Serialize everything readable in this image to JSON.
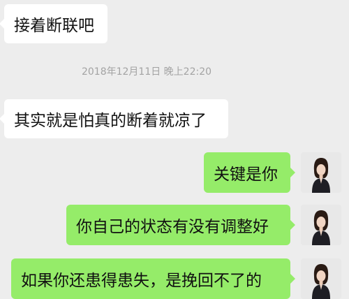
{
  "messages": [
    {
      "side": "received",
      "text": "接着断联吧"
    },
    {
      "side": "received",
      "text": "其实就是怕真的断着就凉了"
    },
    {
      "side": "sent",
      "text": "关键是你"
    },
    {
      "side": "sent",
      "text": "你自己的状态有没有调整好"
    },
    {
      "side": "sent",
      "text": "如果你还患得患失，是挽回不了的"
    }
  ],
  "timestamp": "2018年12月11日 晚上22:20",
  "colors": {
    "background": "#ededed",
    "received_bubble": "#ffffff",
    "sent_bubble": "#95ec69",
    "timestamp_text": "#a3a3a3"
  },
  "icons": {
    "sender_avatar": "woman-portrait-avatar"
  }
}
